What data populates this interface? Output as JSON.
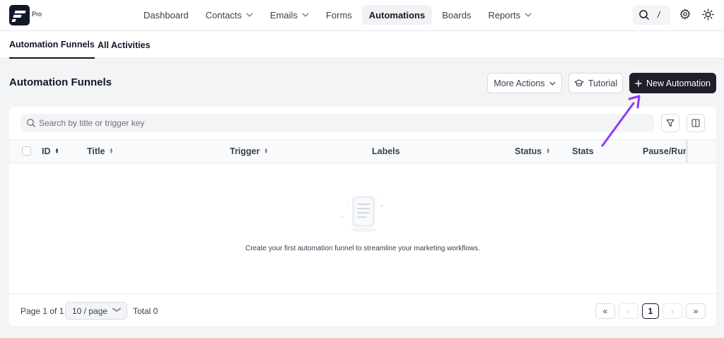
{
  "brand": {
    "badge": "Pro"
  },
  "nav": {
    "items": [
      {
        "label": "Dashboard",
        "dropdown": false,
        "active": false
      },
      {
        "label": "Contacts",
        "dropdown": true,
        "active": false
      },
      {
        "label": "Emails",
        "dropdown": true,
        "active": false
      },
      {
        "label": "Forms",
        "dropdown": false,
        "active": false
      },
      {
        "label": "Automations",
        "dropdown": false,
        "active": true
      },
      {
        "label": "Boards",
        "dropdown": false,
        "active": false
      },
      {
        "label": "Reports",
        "dropdown": true,
        "active": false
      }
    ],
    "search_shortcut": "/"
  },
  "tabs": [
    {
      "label": "Automation Funnels",
      "active": true
    },
    {
      "label": "All Activities",
      "active": false
    }
  ],
  "header": {
    "title": "Automation Funnels",
    "more_actions": "More Actions",
    "tutorial": "Tutorial",
    "new_automation": "New Automation"
  },
  "search": {
    "placeholder": "Search by title or trigger key",
    "value": ""
  },
  "table": {
    "columns": [
      {
        "label": "ID",
        "sortable": true
      },
      {
        "label": "Title",
        "sortable": true
      },
      {
        "label": "Trigger",
        "sortable": true
      },
      {
        "label": "Labels",
        "sortable": false
      },
      {
        "label": "Status",
        "sortable": true
      },
      {
        "label": "Stats",
        "sortable": false
      },
      {
        "label": "Pause/Run",
        "sortable": false
      }
    ],
    "rows": [],
    "empty_message": "Create your first automation funnel to streamline your marketing workflows."
  },
  "pagination": {
    "page_info": "Page 1 of 1",
    "page_size": "10 / page",
    "total": "Total 0",
    "current_page": "1",
    "first": "«",
    "prev": "‹",
    "next": "›",
    "last": "»"
  },
  "colors": {
    "primary_dark": "#1e1f2b",
    "annotation_arrow": "#8b3cf5",
    "background": "#f3f4f6"
  }
}
